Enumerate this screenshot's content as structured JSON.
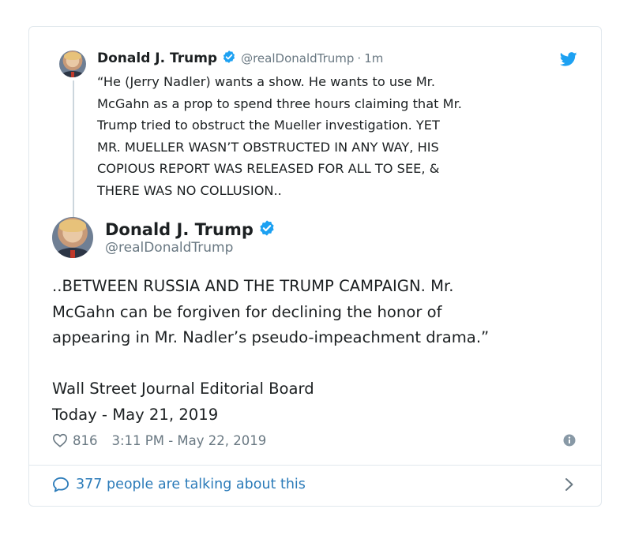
{
  "parent_tweet": {
    "name": "Donald J. Trump",
    "handle": "@realDonaldTrump",
    "separator": "·",
    "time": "1m",
    "text": "“He (Jerry Nadler) wants a show. He wants to use Mr.\nMcGahn as a prop to spend three hours claiming that Mr.\nTrump tried to obstruct the Mueller investigation. YET\nMR. MUELLER WASN’T OBSTRUCTED IN ANY WAY, HIS\nCOPIOUS REPORT WAS RELEASED FOR ALL TO SEE, &\nTHERE WAS NO COLLUSION.."
  },
  "main_tweet": {
    "name": "Donald J. Trump",
    "handle": "@realDonaldTrump",
    "text": "..BETWEEN RUSSIA AND THE TRUMP CAMPAIGN. Mr.\nMcGahn can be forgiven for declining the honor of\nappearing in Mr. Nadler’s pseudo-impeachment drama.”\n\nWall Street Journal Editorial Board\nToday - May 21, 2019",
    "likes": "816",
    "timestamp": "3:11 PM - May 22, 2019"
  },
  "footer": {
    "label": "377 people are talking about this"
  },
  "icons": {
    "verified": "verified-badge-icon",
    "twitter": "twitter-bird-icon",
    "like": "heart-icon",
    "info": "info-icon",
    "reply": "speech-bubble-icon",
    "chevron": "chevron-right-icon"
  },
  "colors": {
    "accent": "#1da1f2",
    "link": "#2b7bb9",
    "muted": "#697882",
    "border": "#e1e8ed",
    "text": "#1c2022"
  }
}
